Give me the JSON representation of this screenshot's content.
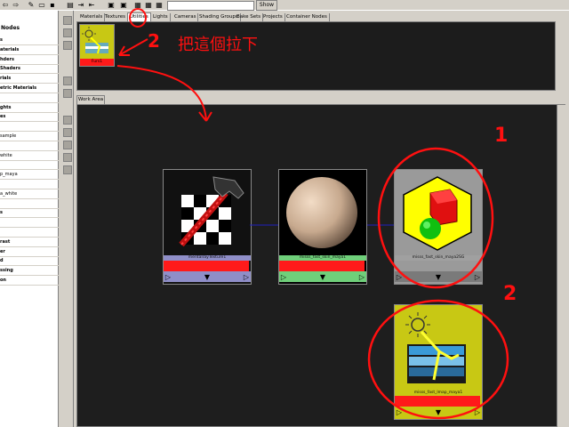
{
  "toolbar": {
    "show_label": "Show"
  },
  "left_panel": {
    "header": "Nodes",
    "items": [
      {
        "label": "s",
        "bold": true
      },
      {
        "label": "aterials",
        "bold": true
      },
      {
        "label": "hders",
        "bold": true
      },
      {
        "label": "Shaders",
        "bold": true
      },
      {
        "label": "rials",
        "bold": true
      },
      {
        "label": "etric Materials",
        "bold": true
      },
      {
        "label": "",
        "bold": false
      },
      {
        "label": "ghts",
        "bold": true
      },
      {
        "label": "es",
        "bold": true
      },
      {
        "label": "",
        "bold": false
      },
      {
        "label": "sample",
        "bold": false
      },
      {
        "label": "",
        "bold": false
      },
      {
        "label": "white",
        "bold": false
      },
      {
        "label": "",
        "bold": false
      },
      {
        "label": "p_maya",
        "bold": false
      },
      {
        "label": "",
        "bold": false
      },
      {
        "label": "a_white",
        "bold": false
      },
      {
        "label": "",
        "bold": false
      },
      {
        "label": "s",
        "bold": true
      },
      {
        "label": "",
        "bold": false
      },
      {
        "label": "",
        "bold": false
      },
      {
        "label": "rast",
        "bold": true
      },
      {
        "label": "er",
        "bold": true
      },
      {
        "label": "d",
        "bold": true
      },
      {
        "label": "ssing",
        "bold": true
      },
      {
        "label": "on",
        "bold": true
      }
    ]
  },
  "tabs": [
    "Materials",
    "Textures",
    "Utilities",
    "Lights",
    "Cameras",
    "Shading Groups",
    "Bake Sets",
    "Projects",
    "Container Nodes"
  ],
  "top_node": {
    "label": "Furs1"
  },
  "annotation_text": "把這個拉下",
  "annotation_numbers": [
    "2",
    "1",
    "2"
  ],
  "work_area_tab": "Work Area",
  "nodes": [
    {
      "label": "mentalrayTexture1",
      "color": "#8f8ec8",
      "bar_color": "#8f8ec8"
    },
    {
      "label": "misss_fast_skin_maya1",
      "color": "#6fcf7a",
      "bar_color": "#6fcf7a"
    },
    {
      "label": "misss_fast_skin_maya2SG",
      "color": "#a0a0a0",
      "bar_color": "#7a7a7a"
    },
    {
      "label": "misss_fast_lmap_maya1",
      "color": "#c8c814",
      "bar_color": "#c8c814"
    }
  ],
  "colors": {
    "accent_red": "#ff1010",
    "work_bg": "#1e1e1e"
  }
}
